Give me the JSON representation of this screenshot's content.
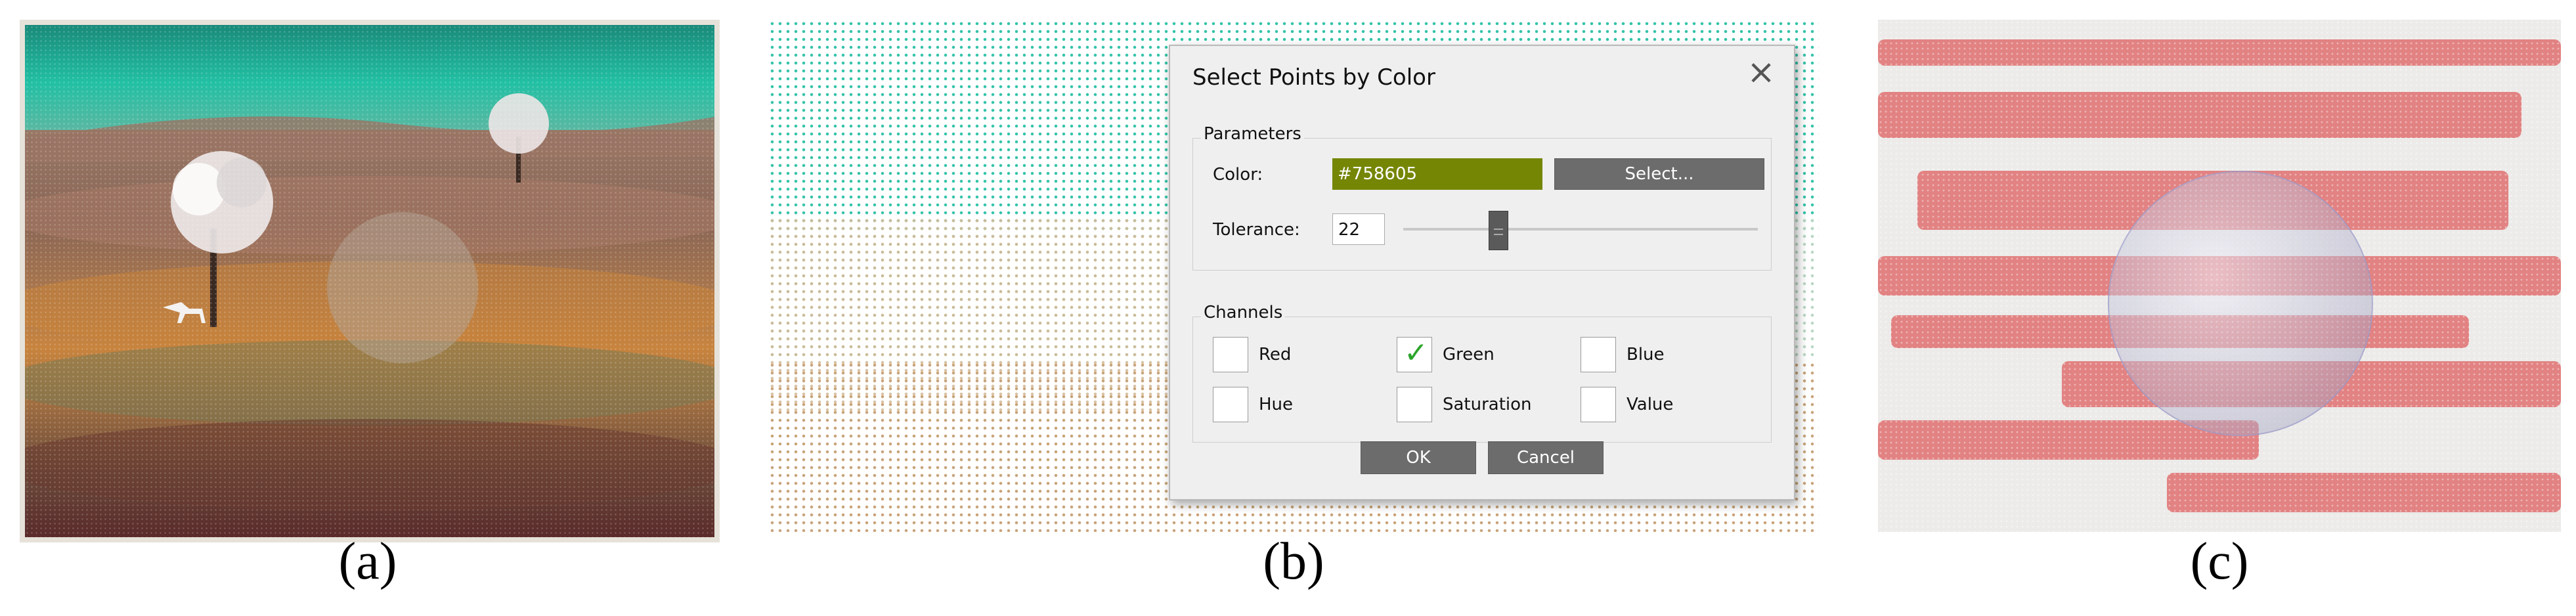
{
  "captions": {
    "a": "(a)",
    "b": "(b)",
    "c": "(c)"
  },
  "dialog": {
    "title": "Select Points by Color",
    "close_icon": "close-icon",
    "parameters": {
      "group_label": "Parameters",
      "color_label": "Color:",
      "color_value": "#758605",
      "color_hex": "#758605",
      "select_button": "Select...",
      "tolerance_label": "Tolerance:",
      "tolerance_value": "22"
    },
    "channels": {
      "group_label": "Channels",
      "items": [
        {
          "label": "Red",
          "checked": false
        },
        {
          "label": "Green",
          "checked": true
        },
        {
          "label": "Blue",
          "checked": false
        },
        {
          "label": "Hue",
          "checked": false
        },
        {
          "label": "Saturation",
          "checked": false
        },
        {
          "label": "Value",
          "checked": false
        }
      ]
    },
    "ok_button": "OK",
    "cancel_button": "Cancel"
  }
}
